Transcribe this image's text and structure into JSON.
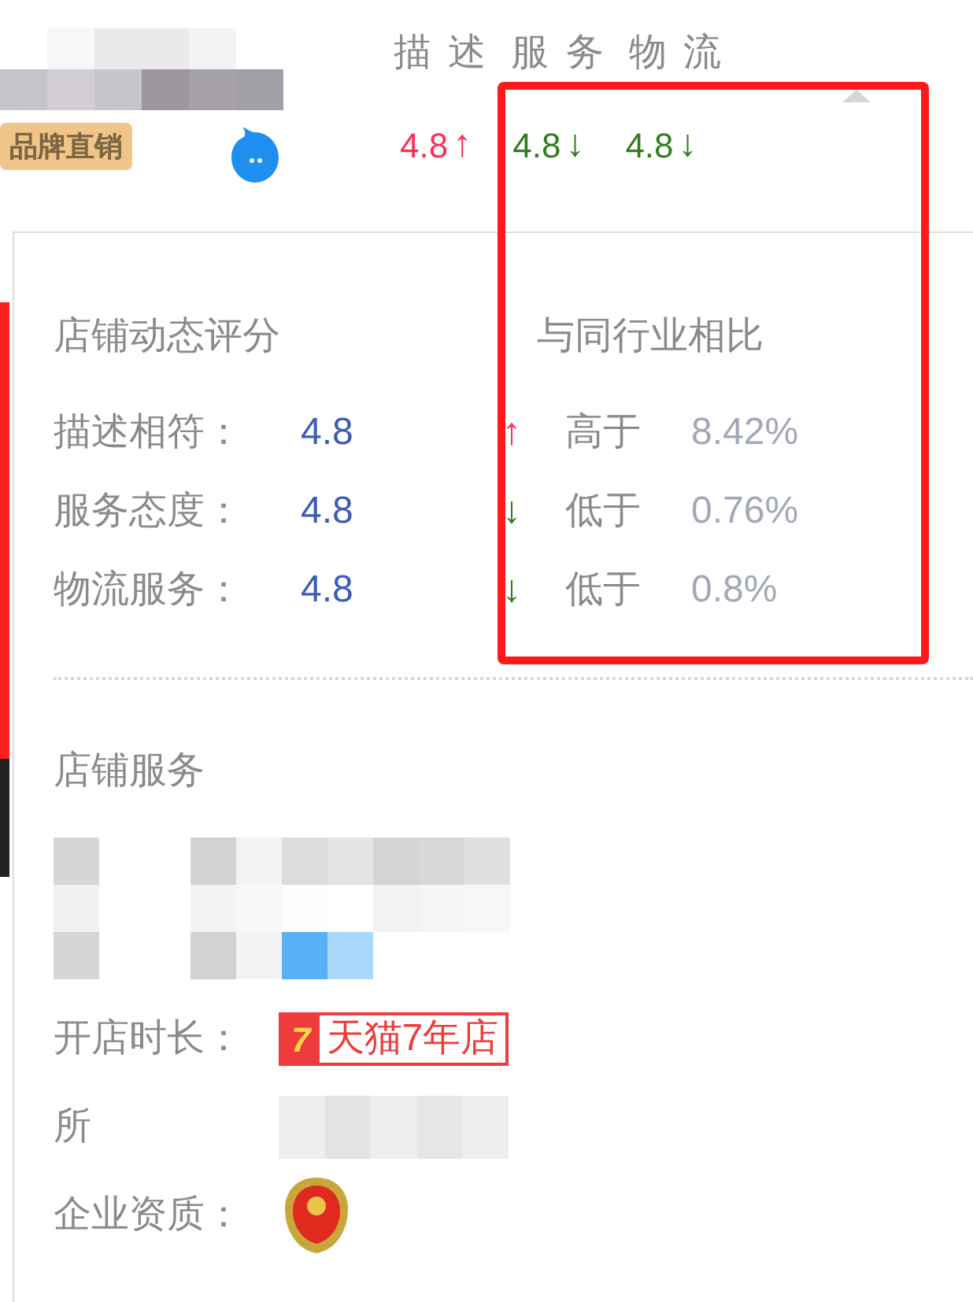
{
  "header": {
    "badge": "品牌直销",
    "score_labels": [
      "描 述",
      "服 务",
      "物 流"
    ],
    "scores": [
      {
        "value": "4.8",
        "higher": true,
        "arrow": "↑"
      },
      {
        "value": "4.8",
        "higher": false,
        "arrow": "↓"
      },
      {
        "value": "4.8",
        "higher": false,
        "arrow": "↓"
      }
    ]
  },
  "popup": {
    "rating_title": "店铺动态评分",
    "compare_title": "与同行业相比",
    "ratings": [
      {
        "label": "描述相符：",
        "value": "4.8",
        "higher": true,
        "arrow": "↑",
        "comparison": "高于",
        "percent": "8.42%"
      },
      {
        "label": "服务态度：",
        "value": "4.8",
        "higher": false,
        "arrow": "↓",
        "comparison": "低于",
        "percent": "0.76%"
      },
      {
        "label": "物流服务：",
        "value": "4.8",
        "higher": false,
        "arrow": "↓",
        "comparison": "低于",
        "percent": "0.8%"
      }
    ],
    "services_title": "店铺服务",
    "services": [
      {
        "kind": "redacted"
      },
      {
        "kind": "badge",
        "label": "开店时长：",
        "badge_number": "7",
        "badge_text": "天猫7年店"
      },
      {
        "kind": "partial",
        "label": "所"
      },
      {
        "kind": "emblem",
        "label": "企业资质："
      }
    ]
  }
}
